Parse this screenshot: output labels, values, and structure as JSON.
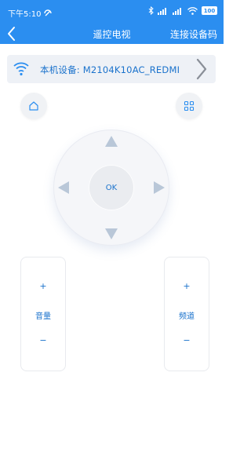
{
  "status_bar": {
    "time": "下午5:10",
    "battery": "100"
  },
  "app_bar": {
    "title": "遥控电视",
    "connect_label": "连接设备码"
  },
  "device": {
    "label": "本机设备: M2104K10AC_REDMI"
  },
  "dpad": {
    "ok_label": "OK"
  },
  "volume": {
    "plus": "+",
    "name": "音量",
    "minus": "−"
  },
  "channel": {
    "plus": "+",
    "name": "频道",
    "minus": "−"
  },
  "colors": {
    "primary": "#2b8ef0",
    "accent_text": "#1a72cc",
    "arrow": "#b9c7d8",
    "panel": "#eef1f6"
  },
  "icons": {
    "back": "chevron-left-icon",
    "wifi": "wifi-icon",
    "device_chevron": "chevron-right-icon",
    "home": "home-icon",
    "menu": "grid-icon"
  }
}
